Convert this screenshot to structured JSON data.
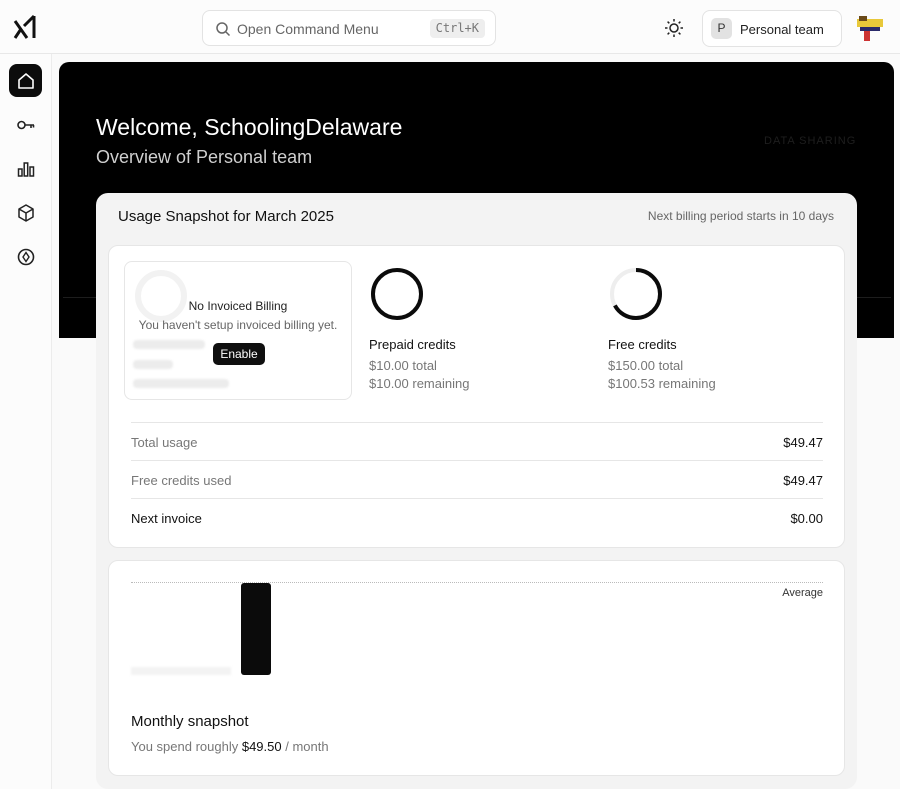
{
  "header": {
    "command_menu": {
      "placeholder": "Open Command Menu",
      "shortcut": "Ctrl+K"
    },
    "team": {
      "avatar_letter": "P",
      "label": "Personal team"
    }
  },
  "sidebar": {
    "items": [
      {
        "name": "home",
        "icon": "home-icon",
        "active": true
      },
      {
        "name": "api-keys",
        "icon": "key-icon",
        "active": false
      },
      {
        "name": "usage",
        "icon": "bar-chart-icon",
        "active": false
      },
      {
        "name": "models",
        "icon": "cube-icon",
        "active": false
      },
      {
        "name": "billing",
        "icon": "compass-icon",
        "active": false
      }
    ]
  },
  "hero": {
    "welcome": "Welcome, SchoolingDelaware",
    "subtitle": "Overview of Personal team",
    "faint_label": "DATA SHARING"
  },
  "usage": {
    "title": "Usage Snapshot for March 2025",
    "next_billing": "Next billing period starts in 10 days",
    "invoiced": {
      "title": "No Invoiced Billing",
      "subtitle": "You haven't setup invoiced billing yet.",
      "button": "Enable"
    },
    "prepaid": {
      "name": "Prepaid credits",
      "total": "$10.00 total",
      "remaining": "$10.00 remaining",
      "remaining_fraction": 1.0
    },
    "free": {
      "name": "Free credits",
      "total": "$150.00 total",
      "remaining": "$100.53 remaining",
      "remaining_fraction": 0.67
    },
    "rows": [
      {
        "label": "Total usage",
        "value": "$49.47"
      },
      {
        "label": "Free credits used",
        "value": "$49.47"
      },
      {
        "label": "Next invoice",
        "value": "$0.00"
      }
    ]
  },
  "snapshot": {
    "average_label": "Average",
    "title": "Monthly snapshot",
    "prefix": "You spend roughly ",
    "amount": "$49.50",
    "suffix": " / month"
  },
  "colors": {
    "accent": "#000000",
    "muted_text": "#777777"
  }
}
